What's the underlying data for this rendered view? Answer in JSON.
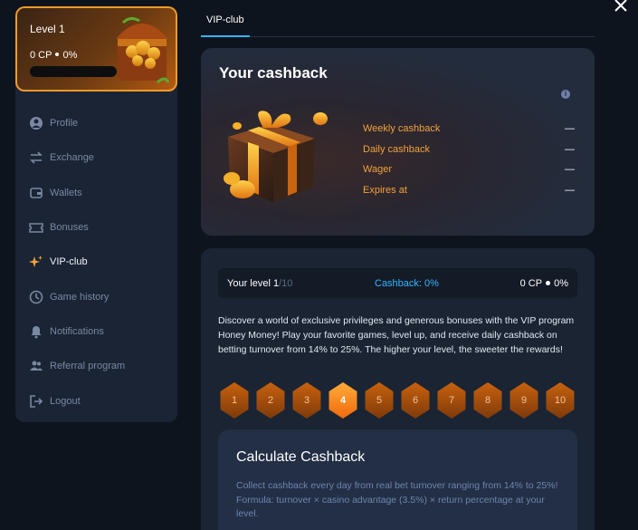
{
  "level_card": {
    "title": "Level 1",
    "cp": "0 CP",
    "percent": "0%",
    "progress": 0
  },
  "nav": {
    "items": [
      {
        "label": "Profile",
        "icon": "user-icon"
      },
      {
        "label": "Exchange",
        "icon": "exchange-icon"
      },
      {
        "label": "Wallets",
        "icon": "wallet-icon"
      },
      {
        "label": "Bonuses",
        "icon": "ticket-icon"
      },
      {
        "label": "VIP-club",
        "icon": "sparkle-icon",
        "active": true
      },
      {
        "label": "Game history",
        "icon": "clock-icon"
      },
      {
        "label": "Notifications",
        "icon": "bell-icon"
      },
      {
        "label": "Referral program",
        "icon": "users-icon"
      },
      {
        "label": "Logout",
        "icon": "logout-icon"
      }
    ]
  },
  "tabs": {
    "active": "VIP-club"
  },
  "cashback": {
    "title": "Your cashback",
    "info_icon": "i",
    "rows": [
      {
        "label": "Weekly cashback",
        "value": "—"
      },
      {
        "label": "Daily cashback",
        "value": "—"
      },
      {
        "label": "Wager",
        "value": "—"
      },
      {
        "label": "Expires at",
        "value": "—"
      }
    ]
  },
  "level_strip": {
    "level_label": "Your level",
    "level_current": "1",
    "level_total": "/10",
    "cashback": "Cashback: 0%",
    "cp": "0 CP",
    "percent": "0%"
  },
  "description": "Discover a world of exclusive privileges and generous bonuses with the VIP program Honey Money! Play your favorite games, level up, and receive daily cashback on betting turnover from 14% to 25%. The higher your level, the sweeter the rewards!",
  "levels": [
    "1",
    "2",
    "3",
    "4",
    "5",
    "6",
    "7",
    "8",
    "9",
    "10"
  ],
  "selected_level": "4",
  "calculator": {
    "title": "Calculate Cashback",
    "text": "Collect cashback every day from real bet turnover ranging from 14% to 25%! Formula: turnover × casino advantage (3.5%) × return percentage at your level."
  },
  "colors": {
    "accent": "#31b6ff",
    "orange": "#f2a23b",
    "panel": "#1a2433"
  }
}
